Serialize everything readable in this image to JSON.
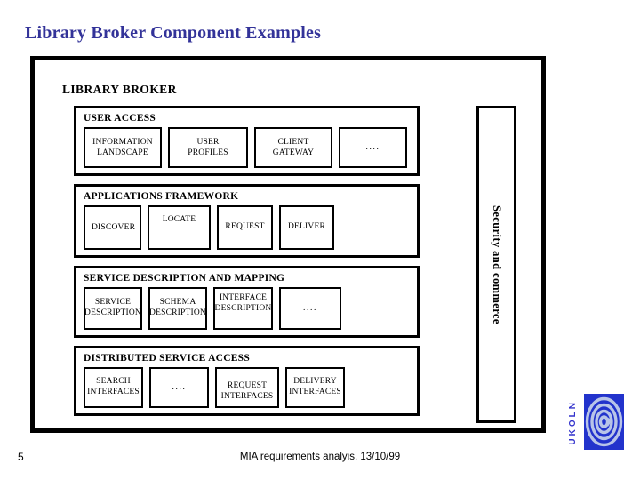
{
  "slide": {
    "title": "Library Broker Component Examples",
    "title_color": "#333399"
  },
  "diagram": {
    "outer_label": "LIBRARY BROKER",
    "side_bar": {
      "label": "Security and commerce",
      "orientation": "vertical"
    },
    "layers": [
      {
        "id": "user-access",
        "title": "USER ACCESS",
        "components": [
          "INFORMATION\nLANDSCAPE",
          "USER\nPROFILES",
          "CLIENT\nGATEWAY",
          "...."
        ]
      },
      {
        "id": "applications-framework",
        "title": "APPLICATIONS FRAMEWORK",
        "components": [
          "DISCOVER",
          "LOCATE",
          "REQUEST",
          "DELIVER"
        ]
      },
      {
        "id": "service-description",
        "title": "SERVICE DESCRIPTION AND MAPPING",
        "components": [
          "SERVICE\nDESCRIPTION",
          "SCHEMA\nDESCRIPTION",
          "INTERFACE\nDESCRIPTION",
          "...."
        ]
      },
      {
        "id": "distributed-service-access",
        "title": "DISTRIBUTED SERVICE ACCESS",
        "components": [
          "SEARCH\nINTERFACES",
          "....",
          "REQUEST\nINTERFACES",
          "DELIVERY\nINTERFACES"
        ]
      }
    ]
  },
  "footer": {
    "page_number": "5",
    "caption": "MIA requirements analyis, 13/10/99",
    "logo_wordmark": "UKOLN",
    "logo_color": "#2233cc",
    "logo_spiral_color": "#b8c4e8"
  }
}
